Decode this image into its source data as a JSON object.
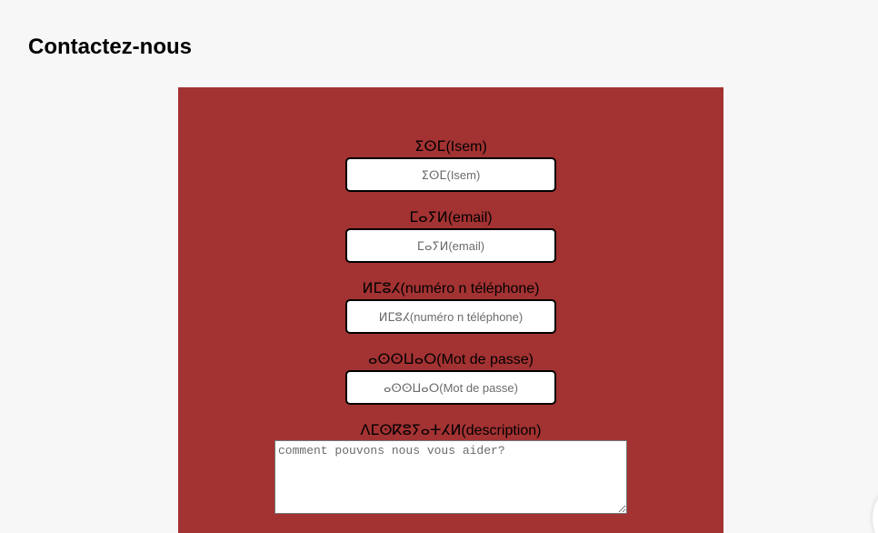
{
  "page": {
    "title": "Contactez-nous"
  },
  "form": {
    "fields": [
      {
        "label": "ⵉⵙⵎ(Isem)",
        "placeholder": "ⵉⵙⵎ(Isem)",
        "value": ""
      },
      {
        "label": "ⵎⴰⵢⵍ(email)",
        "placeholder": "ⵎⴰⵢⵍ(email)",
        "value": ""
      },
      {
        "label": "ⵍⵎⵓⵃ(numéro n téléphone)",
        "placeholder": "ⵍⵎⵓⵃ(numéro n téléphone)",
        "value": ""
      },
      {
        "label": "ⴰⵙⵙⵡⴰⵔ(Mot de passe)",
        "placeholder": "ⴰⵙⵙⵡⴰⵔ(Mot de passe)",
        "value": ""
      }
    ],
    "description": {
      "label": "ⴷⵎⵙⴽⵓⵢⴰⵜⵃⵍ(description)",
      "placeholder": "comment pouvons nous vous aider?",
      "value": ""
    }
  },
  "colors": {
    "page_background": "#f7f7f7",
    "panel_background": "#a33232",
    "input_border": "#000000"
  }
}
